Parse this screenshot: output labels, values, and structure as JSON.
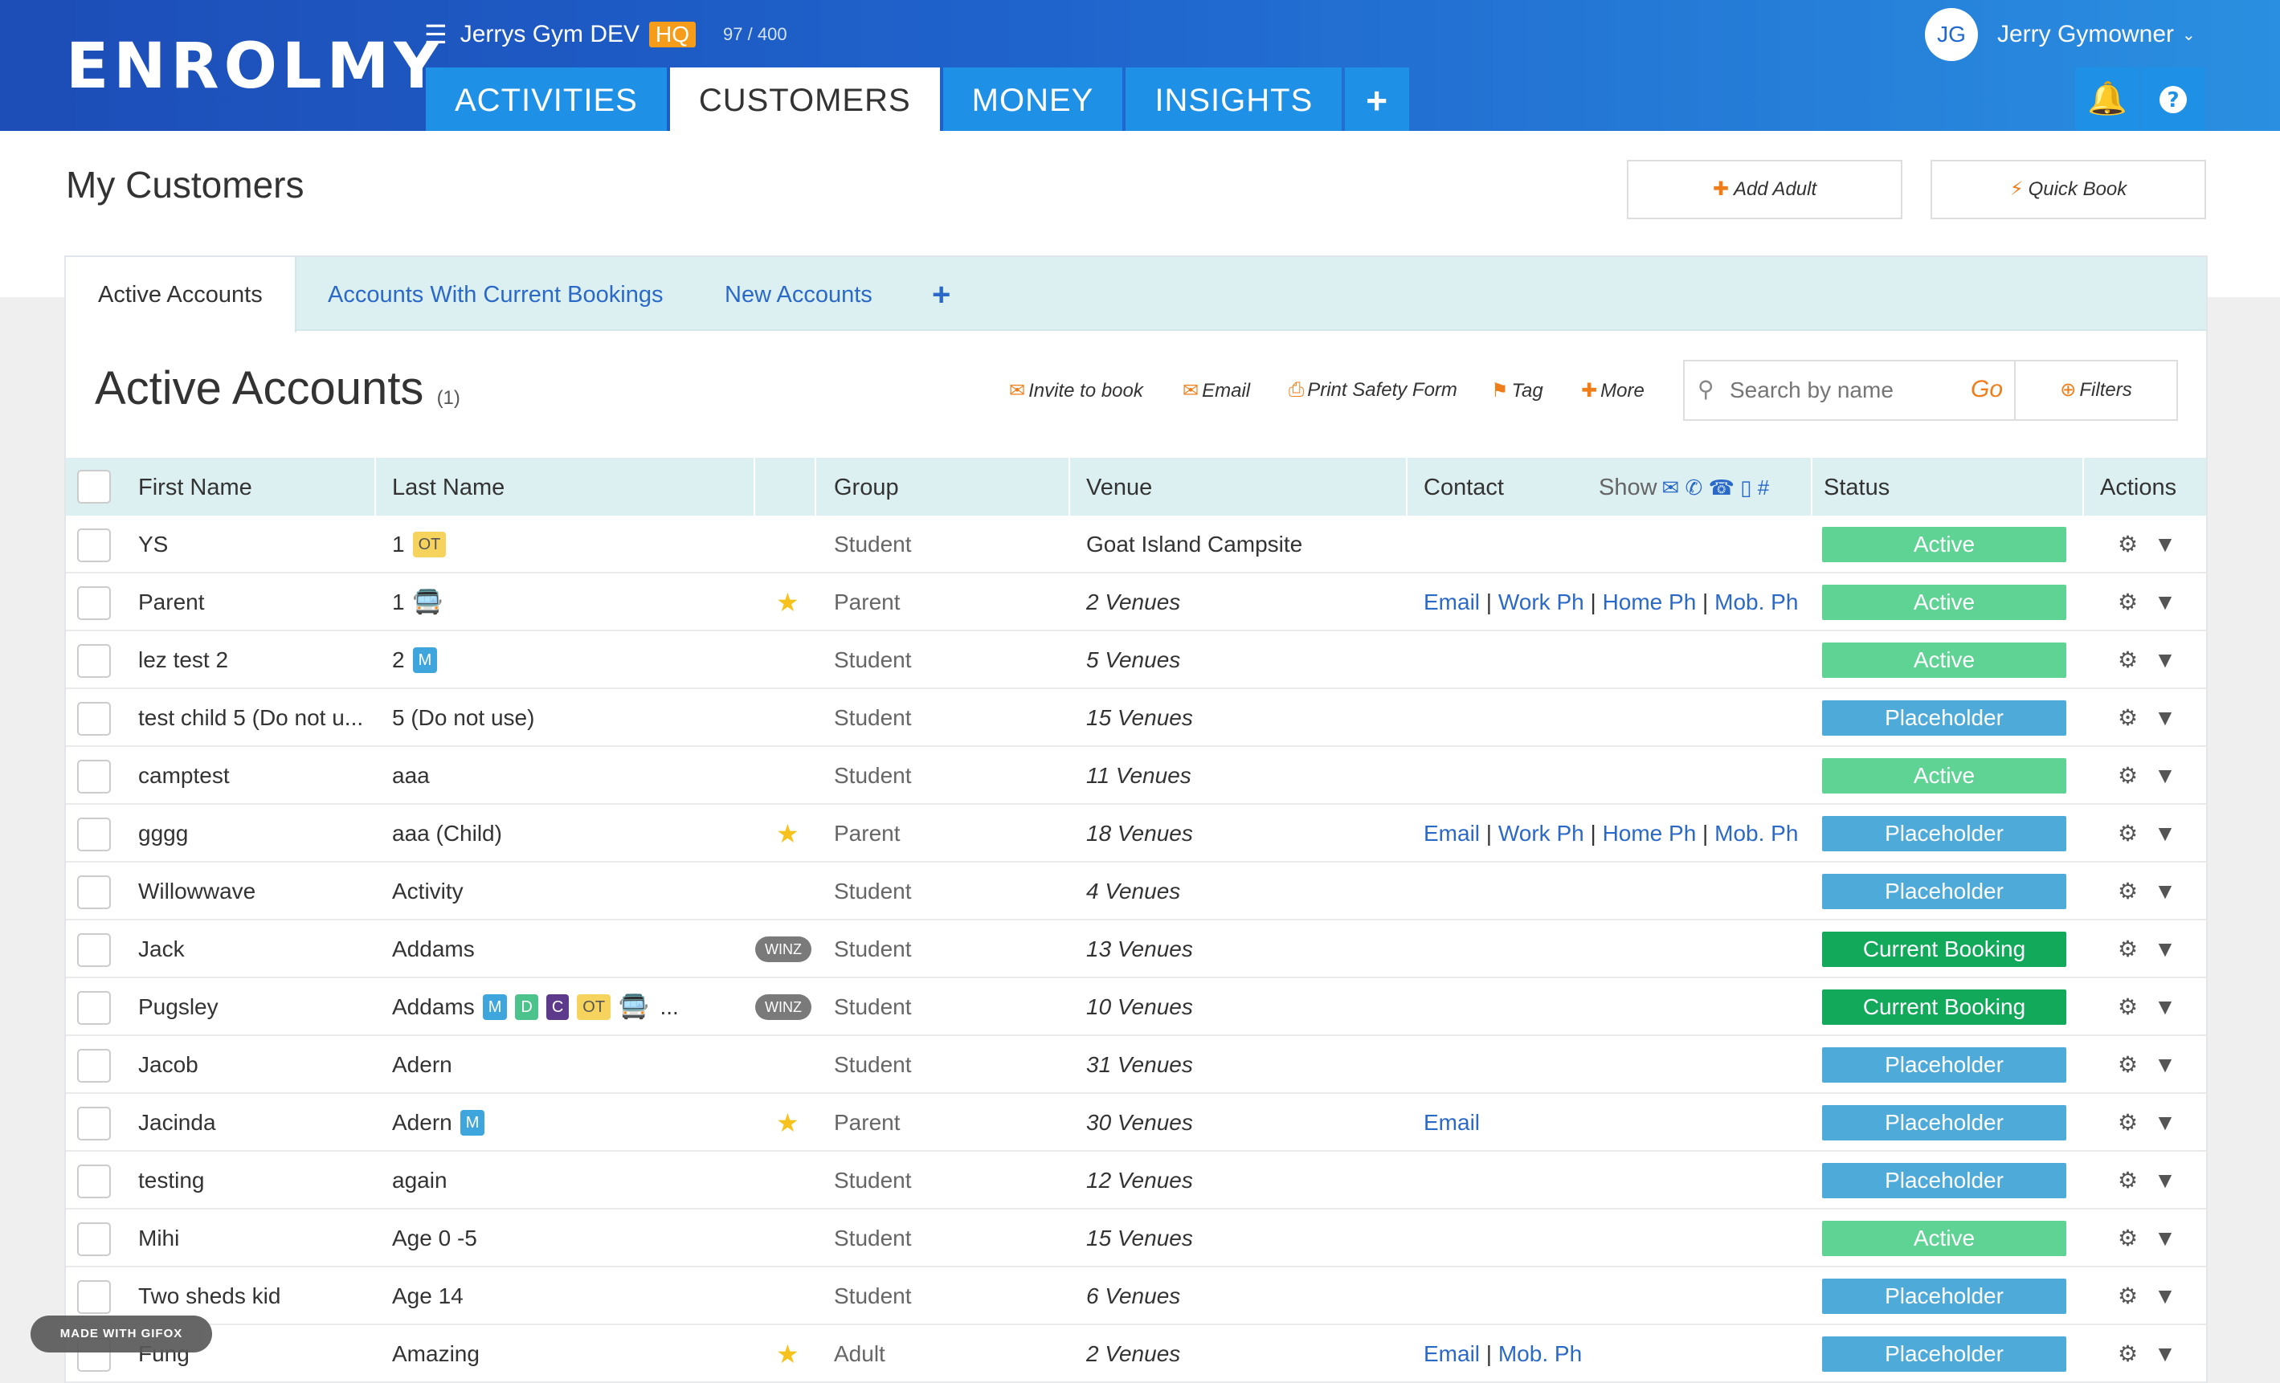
{
  "header": {
    "logo": "ENROLMY",
    "gym_name": "Jerrys Gym DEV",
    "hq_label": "HQ",
    "count": "97 / 400",
    "nav_tabs": [
      "ACTIVITIES",
      "CUSTOMERS",
      "MONEY",
      "INSIGHTS"
    ],
    "active_tab": "CUSTOMERS",
    "plus_label": "+",
    "user_initials": "JG",
    "user_name": "Jerry Gymowner"
  },
  "page": {
    "title": "My Customers",
    "add_adult_label": "Add Adult",
    "quick_book_label": "Quick Book"
  },
  "panel": {
    "tabs": [
      "Active Accounts",
      "Accounts With Current Bookings",
      "New Accounts"
    ],
    "tab_plus": "+",
    "heading": "Active Accounts",
    "heading_count": "(1)",
    "tools": {
      "invite": "Invite to book",
      "email": "Email",
      "print": "Print Safety Form",
      "tag": "Tag",
      "more": "More"
    },
    "search_placeholder": "Search by name",
    "go_label": "Go",
    "filters_label": "Filters"
  },
  "table": {
    "columns": {
      "first_name": "First Name",
      "last_name": "Last Name",
      "group": "Group",
      "venue": "Venue",
      "contact": "Contact",
      "show": "Show",
      "status": "Status",
      "actions": "Actions"
    },
    "rows": [
      {
        "first": "YS",
        "last": "1",
        "badges": [
          "OT"
        ],
        "star": false,
        "winz": false,
        "group": "Student",
        "venue": "Goat Island Campsite",
        "venue_italic": false,
        "contact": [],
        "status": "Active"
      },
      {
        "first": "Parent",
        "last": "1",
        "badges": [
          "bus"
        ],
        "star": true,
        "winz": false,
        "group": "Parent",
        "venue": "2 Venues",
        "venue_italic": true,
        "contact": [
          "Email",
          "Work Ph",
          "Home Ph",
          "Mob. Ph"
        ],
        "status": "Active"
      },
      {
        "first": "lez test 2",
        "last": "2",
        "badges": [
          "M"
        ],
        "star": false,
        "winz": false,
        "group": "Student",
        "venue": "5 Venues",
        "venue_italic": true,
        "contact": [],
        "status": "Active"
      },
      {
        "first": "test child 5 (Do not u...",
        "last": "5 (Do not use)",
        "badges": [],
        "star": false,
        "winz": false,
        "group": "Student",
        "venue": "15 Venues",
        "venue_italic": true,
        "contact": [],
        "status": "Placeholder"
      },
      {
        "first": "camptest",
        "last": "aaa",
        "badges": [],
        "star": false,
        "winz": false,
        "group": "Student",
        "venue": "11 Venues",
        "venue_italic": true,
        "contact": [],
        "status": "Active"
      },
      {
        "first": "gggg",
        "last": "aaa (Child)",
        "badges": [],
        "star": true,
        "winz": false,
        "group": "Parent",
        "venue": "18 Venues",
        "venue_italic": true,
        "contact": [
          "Email",
          "Work Ph",
          "Home Ph",
          "Mob. Ph"
        ],
        "status": "Placeholder"
      },
      {
        "first": "Willowwave",
        "last": "Activity",
        "badges": [],
        "star": false,
        "winz": false,
        "group": "Student",
        "venue": "4 Venues",
        "venue_italic": true,
        "contact": [],
        "status": "Placeholder"
      },
      {
        "first": "Jack",
        "last": "Addams",
        "badges": [],
        "star": false,
        "winz": true,
        "group": "Student",
        "venue": "13 Venues",
        "venue_italic": true,
        "contact": [],
        "status": "Current Booking"
      },
      {
        "first": "Pugsley",
        "last": "Addams",
        "badges": [
          "M",
          "D",
          "C",
          "OT",
          "bus",
          "more"
        ],
        "star": false,
        "winz": true,
        "group": "Student",
        "venue": "10 Venues",
        "venue_italic": true,
        "contact": [],
        "status": "Current Booking"
      },
      {
        "first": "Jacob",
        "last": "Adern",
        "badges": [],
        "star": false,
        "winz": false,
        "group": "Student",
        "venue": "31 Venues",
        "venue_italic": true,
        "contact": [],
        "status": "Placeholder"
      },
      {
        "first": "Jacinda",
        "last": "Adern",
        "badges": [
          "M"
        ],
        "star": true,
        "winz": false,
        "group": "Parent",
        "venue": "30 Venues",
        "venue_italic": true,
        "contact": [
          "Email"
        ],
        "status": "Placeholder"
      },
      {
        "first": "testing",
        "last": "again",
        "badges": [],
        "star": false,
        "winz": false,
        "group": "Student",
        "venue": "12 Venues",
        "venue_italic": true,
        "contact": [],
        "status": "Placeholder"
      },
      {
        "first": "Mihi",
        "last": "Age 0 -5",
        "badges": [],
        "star": false,
        "winz": false,
        "group": "Student",
        "venue": "15 Venues",
        "venue_italic": true,
        "contact": [],
        "status": "Active"
      },
      {
        "first": "Two sheds kid",
        "last": "Age 14",
        "badges": [],
        "star": false,
        "winz": false,
        "group": "Student",
        "venue": "6 Venues",
        "venue_italic": true,
        "contact": [],
        "status": "Placeholder"
      },
      {
        "first": "Fung",
        "last": "Amazing",
        "badges": [],
        "star": true,
        "winz": false,
        "group": "Adult",
        "venue": "2 Venues",
        "venue_italic": true,
        "contact": [
          "Email",
          "Mob. Ph"
        ],
        "status": "Placeholder"
      }
    ],
    "winz_label": "WINZ",
    "more_glyph": "..."
  },
  "watermark": "MADE WITH GIFOX",
  "colors": {
    "brand_blue": "#1f63cc",
    "tab_blue": "#1e90e6",
    "accent_orange": "#ef7e1a",
    "status_active": "#5fd393",
    "status_placeholder": "#4eaad9",
    "status_current_booking": "#13a95b"
  }
}
